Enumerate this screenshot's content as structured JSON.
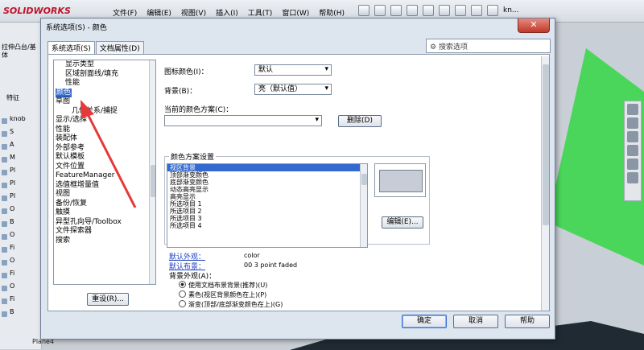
{
  "app": {
    "logo": "SOLIDWORKS",
    "menus": [
      "文件(F)",
      "编辑(E)",
      "视图(V)",
      "插入(I)",
      "工具(T)",
      "窗口(W)",
      "帮助(H)"
    ],
    "user": "kn...",
    "command_label": "拉伸凸台/基体",
    "feature_tab": "特征",
    "tree_items": [
      "knob",
      "S",
      "A",
      "M",
      "Pl",
      "Pl",
      "Pl",
      "O",
      "B",
      "O",
      "Fi",
      "O",
      "Fi",
      "O",
      "Fi",
      "B"
    ],
    "plane_label": "Plane4"
  },
  "dialog": {
    "title": "系统选项(S) - 颜色",
    "close_icon": "close-icon",
    "tabs": [
      "系统选项(S)",
      "文档属性(D)"
    ],
    "search_placeholder": "搜索选项",
    "tree": [
      {
        "label": "显示类型",
        "indent": 1
      },
      {
        "label": "区域剖面线/填充",
        "indent": 1
      },
      {
        "label": "性能",
        "indent": 1
      },
      {
        "label": "颜色",
        "indent": 0,
        "selected": true
      },
      {
        "label": "草图",
        "indent": 0
      },
      {
        "label": "几何关系/捕捉",
        "indent": 2
      },
      {
        "label": "显示/选择",
        "indent": 0
      },
      {
        "label": "性能",
        "indent": 0
      },
      {
        "label": "装配体",
        "indent": 0
      },
      {
        "label": "外部参考",
        "indent": 0
      },
      {
        "label": "默认模板",
        "indent": 0
      },
      {
        "label": "文件位置",
        "indent": 0
      },
      {
        "label": "FeatureManager",
        "indent": 0
      },
      {
        "label": "选值框增量值",
        "indent": 0
      },
      {
        "label": "视图",
        "indent": 0
      },
      {
        "label": "备份/恢复",
        "indent": 0
      },
      {
        "label": "触摸",
        "indent": 0
      },
      {
        "label": "异型孔向导/Toolbox",
        "indent": 0
      },
      {
        "label": "文件探索器",
        "indent": 0
      },
      {
        "label": "搜索",
        "indent": 0
      }
    ],
    "reset_button": "重设(R)...",
    "icon_color_label": "图标颜色(I)：",
    "icon_color_value": "默认",
    "background_label": "背景(B)：",
    "background_value": "亮（默认值）",
    "current_scheme_label": "当前的颜色方案(C)：",
    "current_scheme_value": "",
    "delete_button": "删除(D)",
    "scheme_settings_label": "颜色方案设置",
    "scheme_items": [
      "视区背景",
      "顶部渐变颜色",
      "底部渐变颜色",
      "动态高亮显示",
      "高亮显示",
      "所选项目 1",
      "所选项目 2",
      "所选项目 3",
      "所选项目 4"
    ],
    "scheme_selected": "视区背景",
    "edit_button": "编辑(E)...",
    "default_appearance_label": "默认外观：",
    "default_appearance_value": "color",
    "default_scene_label": "默认布景：",
    "default_scene_value": "00 3 point faded",
    "bg_appearance_label": "背景外观(A)：",
    "radios": [
      {
        "label": "使用文档布景背景(推荐)(U)",
        "checked": true
      },
      {
        "label": "素色(视区背景颜色在上)(P)",
        "checked": false
      },
      {
        "label": "渐变(顶部/底部渐变颜色在上)(G)",
        "checked": false
      }
    ],
    "ok_button": "确定",
    "cancel_button": "取消",
    "help_button": "帮助"
  },
  "colors": {
    "selection": "#3369d0",
    "annotation_arrow": "#e5393a",
    "link": "#1d3fbf"
  }
}
